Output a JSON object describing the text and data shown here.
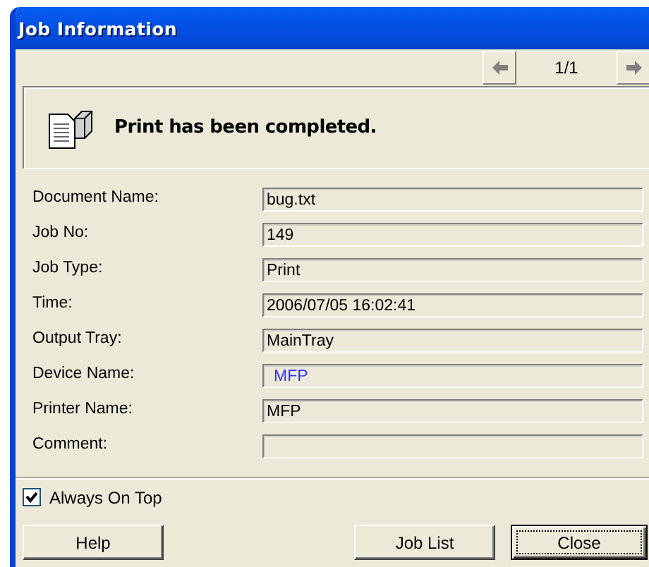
{
  "window": {
    "title": "Job Information"
  },
  "navigation": {
    "counter": "1/1"
  },
  "message": "Print has been completed.",
  "fields": [
    {
      "label": "Document Name:",
      "value": "bug.txt",
      "color": "#000000"
    },
    {
      "label": "Job No:",
      "value": "149",
      "color": "#000000"
    },
    {
      "label": "Job Type:",
      "value": "Print",
      "color": "#000000"
    },
    {
      "label": "Time:",
      "value": "2006/07/05 16:02:41",
      "color": "#000000"
    },
    {
      "label": "Output Tray:",
      "value": "MainTray",
      "color": "#000000"
    },
    {
      "label": "Device Name:",
      "value": "MFP",
      "color": "#3333ff"
    },
    {
      "label": "Printer Name:",
      "value": "MFP",
      "color": "#000000"
    },
    {
      "label": "Comment:"
    }
  ],
  "always_on_top": {
    "label": "Always On Top",
    "checked": true
  },
  "buttons": [
    {
      "label": "Help",
      "focused": false
    },
    {
      "label": "Job List",
      "focused": false
    },
    {
      "label": "Close",
      "focused": true
    }
  ]
}
